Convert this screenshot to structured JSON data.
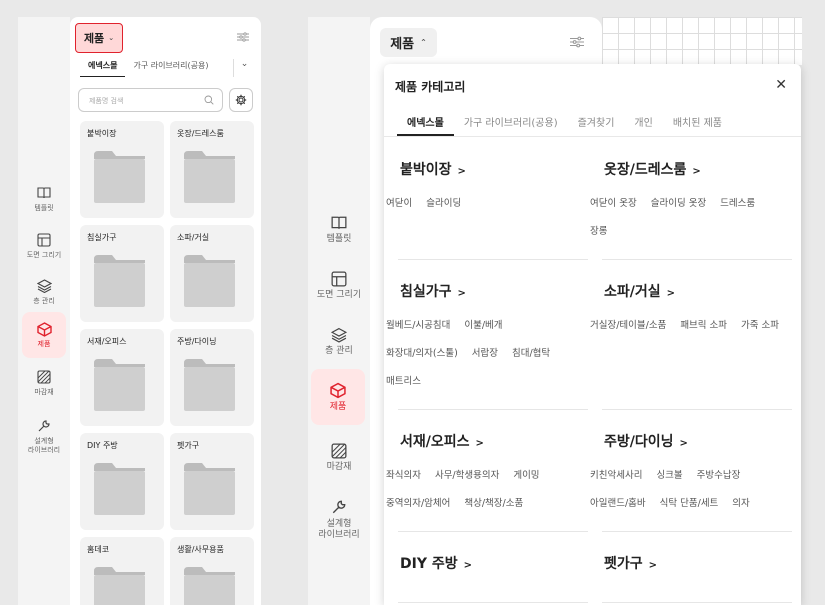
{
  "rail_items": [
    {
      "label": "템플릿",
      "icon": "book-icon"
    },
    {
      "label": "도면 그리기",
      "icon": "floorplan-icon"
    },
    {
      "label": "층 관리",
      "icon": "layers-icon"
    },
    {
      "label": "제품",
      "icon": "box-icon"
    },
    {
      "label": "마감재",
      "icon": "texture-icon"
    },
    {
      "label": "설계형\n라이브러리",
      "icon": "wrench-icon"
    }
  ],
  "left_panel": {
    "dropdown_label": "제품",
    "tabs": [
      "에넥스몰",
      "가구 라이브러리(공용)"
    ],
    "search_placeholder": "제품명 검색",
    "tiles": [
      "붙박이장",
      "옷장/드레스룸",
      "침실가구",
      "소파/거실",
      "서재/오피스",
      "주방/다이닝",
      "DIY 주방",
      "펫가구",
      "홈데코",
      "생활/사무용품"
    ]
  },
  "right_panel": {
    "dropdown_label": "제품"
  },
  "popup": {
    "title": "제품 카테고리",
    "tabs": [
      "에넥스몰",
      "가구 라이브러리(공용)",
      "즐겨찾기",
      "개인",
      "배치된 제품"
    ],
    "categories": [
      {
        "name": "붙박이장",
        "subs": [
          "여닫이",
          "슬라이딩"
        ]
      },
      {
        "name": "옷장/드레스룸",
        "subs": [
          "여닫이 옷장",
          "슬라이딩 옷장",
          "드레스룸",
          "장롱"
        ]
      },
      {
        "name": "침실가구",
        "subs": [
          "월베드/시공침대",
          "이불/베개",
          "화장대/의자(스툴)",
          "서랍장",
          "침대/협탁",
          "매트리스"
        ]
      },
      {
        "name": "소파/거실",
        "subs": [
          "거실장/테이블/소품",
          "패브릭 소파",
          "가죽 소파"
        ]
      },
      {
        "name": "서재/오피스",
        "subs": [
          "좌식의자",
          "사무/학생용의자",
          "게이밍",
          "중역의자/암체어",
          "책상/책장/소품"
        ]
      },
      {
        "name": "주방/다이닝",
        "subs": [
          "키친악세사리",
          "싱크볼",
          "주방수납장",
          "아일랜드/홈바",
          "식탁 단품/세트",
          "의자"
        ]
      },
      {
        "name": "DIY 주방",
        "subs": []
      },
      {
        "name": "펫가구",
        "subs": []
      }
    ]
  },
  "colors": {
    "accent": "#e0222d",
    "accent_bg": "#ffe6e6"
  }
}
